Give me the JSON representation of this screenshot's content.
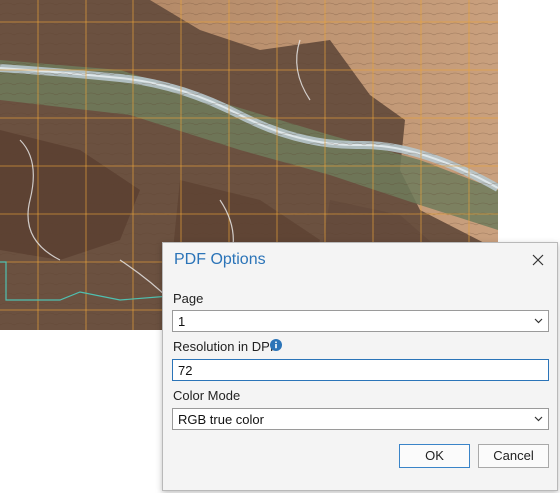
{
  "dialog": {
    "title": "PDF Options",
    "close_icon": "close-icon",
    "page": {
      "label": "Page",
      "selected": "1"
    },
    "resolution": {
      "label": "Resolution in DPI",
      "value": "72",
      "info_icon": "info-icon"
    },
    "color_mode": {
      "label": "Color Mode",
      "selected": "RGB true color"
    },
    "ok_label": "OK",
    "cancel_label": "Cancel"
  },
  "colors": {
    "title_blue": "#2b74b8",
    "dialog_bg": "#f4f4f4",
    "map_brown": "#7a5c45",
    "grid_orange": "#e8a23a",
    "river": "#b7c7cc"
  }
}
